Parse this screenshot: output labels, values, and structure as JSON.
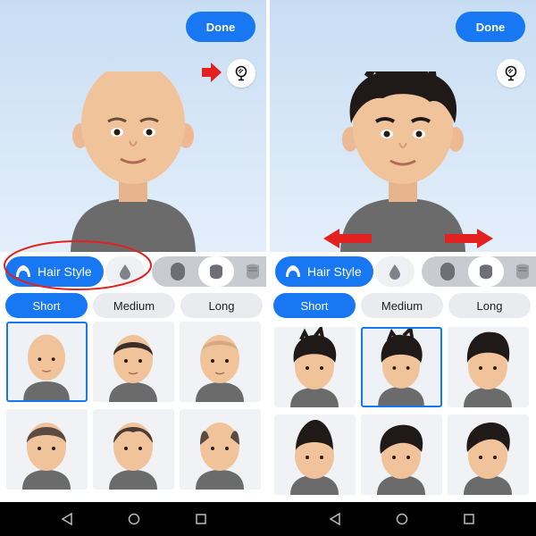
{
  "left": {
    "done_label": "Done",
    "hair_style_label": "Hair Style",
    "filters": [
      "Short",
      "Medium",
      "Long"
    ],
    "active_filter": "Short",
    "selected_style_index": 0
  },
  "right": {
    "done_label": "Done",
    "hair_style_label": "Hair Style",
    "filters": [
      "Short",
      "Medium",
      "Long"
    ],
    "active_filter": "Short",
    "selected_style_index": 1
  },
  "colors": {
    "accent": "#1877f2",
    "annotation_red": "#e32121",
    "skin": "#f1c39b",
    "hair_dark": "#1f1a17",
    "shirt": "#6b6b6b"
  },
  "icons": [
    "mirror-icon",
    "hair-icon",
    "hair-color-icon",
    "head-shape-icon",
    "back-icon",
    "home-icon",
    "recents-icon"
  ]
}
